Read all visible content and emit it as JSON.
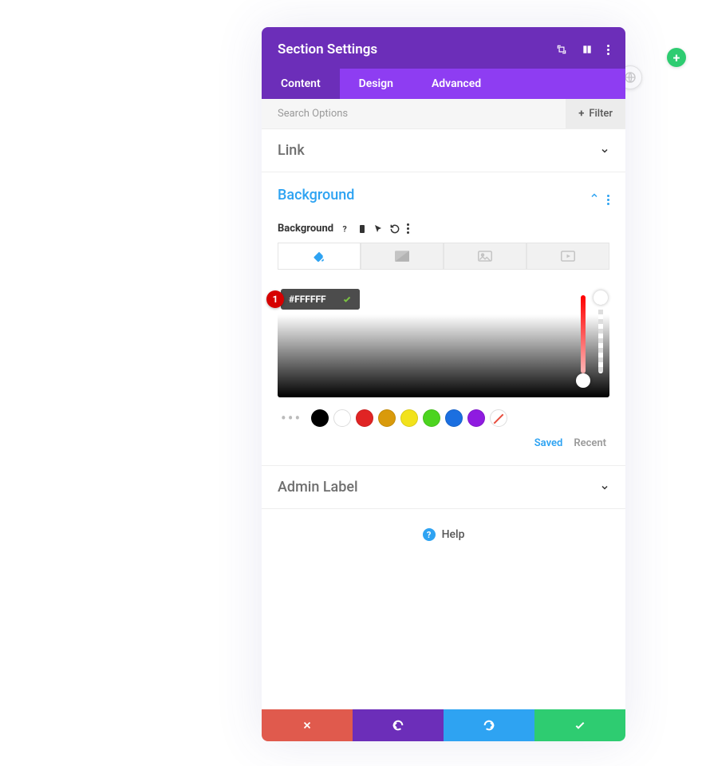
{
  "header": {
    "title": "Section Settings"
  },
  "tabs": [
    {
      "label": "Content",
      "active": true
    },
    {
      "label": "Design",
      "active": false
    },
    {
      "label": "Advanced",
      "active": false
    }
  ],
  "search": {
    "placeholder": "Search Options"
  },
  "filter": {
    "label": "Filter"
  },
  "sections": {
    "link": {
      "title": "Link"
    },
    "background": {
      "title": "Background",
      "field_label": "Background",
      "hex_value": "#FFFFFF",
      "marker": "1",
      "swatches": [
        "#000000",
        "#ffffff",
        "#e02424",
        "#d99a0b",
        "#f2e21b",
        "#4cd41f",
        "#1b6fe0",
        "#8f1be0"
      ],
      "saved_label": "Saved",
      "recent_label": "Recent"
    },
    "admin_label": {
      "title": "Admin Label"
    }
  },
  "help": {
    "label": "Help"
  }
}
